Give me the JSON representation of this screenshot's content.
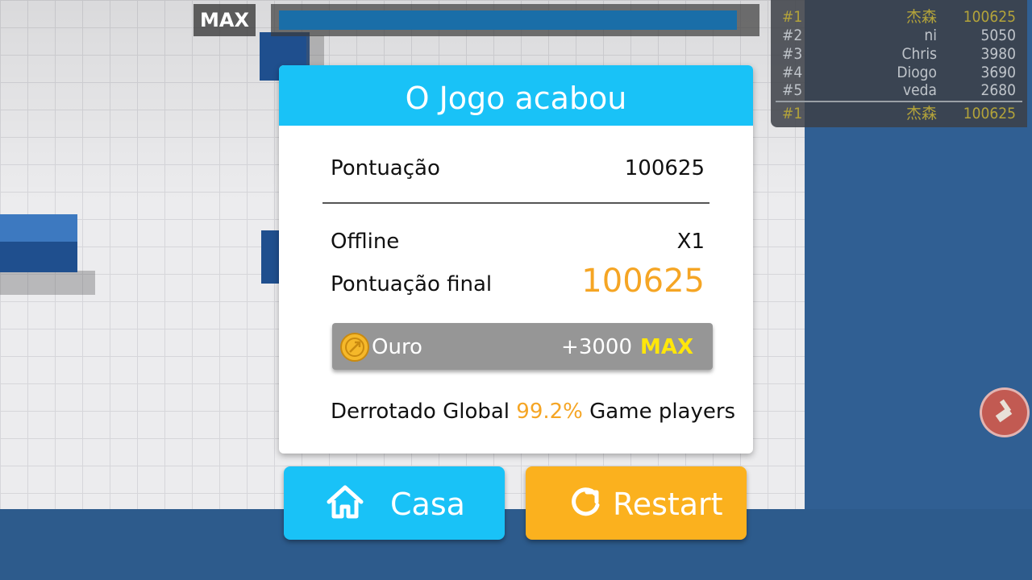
{
  "hud": {
    "max_label": "MAX",
    "progress": 0.97
  },
  "leaderboard": {
    "rows": [
      {
        "rank": "#1",
        "name": "杰森",
        "score": "100625"
      },
      {
        "rank": "#2",
        "name": "ni",
        "score": "5050"
      },
      {
        "rank": "#3",
        "name": "Chris",
        "score": "3980"
      },
      {
        "rank": "#4",
        "name": "Diogo",
        "score": "3690"
      },
      {
        "rank": "#5",
        "name": "veda",
        "score": "2680"
      }
    ],
    "me": {
      "rank": "#1",
      "name": "杰森",
      "score": "100625"
    }
  },
  "modal": {
    "title": "O Jogo acabou",
    "score_label": "Pontuação",
    "score_value": "100625",
    "mode_label": "Offline",
    "mode_value": "X1",
    "final_label": "Pontuação final",
    "final_value": "100625",
    "gold_label": "Ouro",
    "gold_amount": "+3000",
    "gold_max": "MAX",
    "defeated_prefix": "Derrotado Global",
    "defeated_percent": "99.2%",
    "defeated_suffix": "Game players"
  },
  "buttons": {
    "home_label": "Casa",
    "restart_label": "Restart"
  },
  "colors": {
    "header": "#19c2f7",
    "accent_orange": "#f5a524",
    "restart": "#fbb11e",
    "gold_max": "#ffe60a"
  },
  "icons": {
    "home": "home-icon",
    "restart": "restart-icon",
    "coin": "coin-icon",
    "tool": "brush-icon"
  }
}
